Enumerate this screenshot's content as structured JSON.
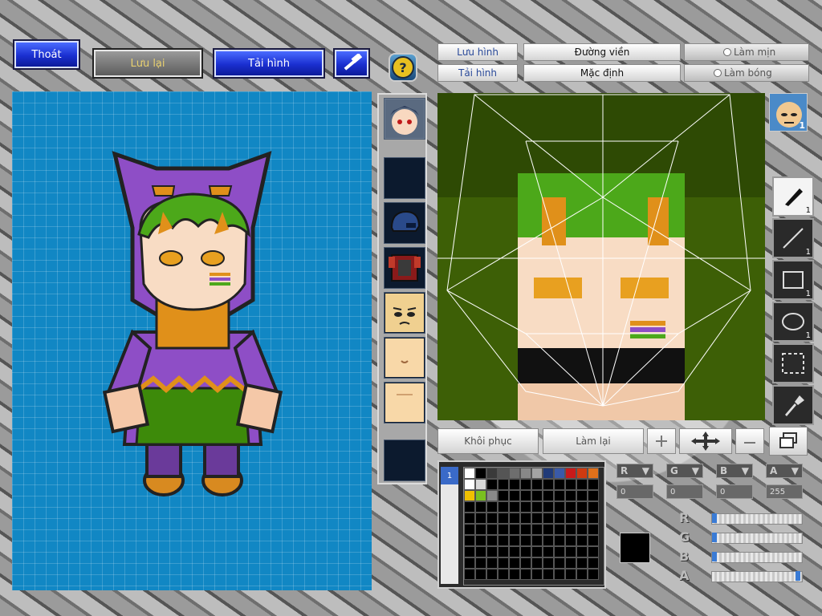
{
  "toolbar": {
    "exit_label": "Thoát",
    "save_label": "Lưu lại",
    "reload_label": "Tải hình",
    "help_symbol": "?"
  },
  "editor_toolbar": {
    "save_image": "Lưu hình",
    "load_image": "Tải hình",
    "outline": "Đường viền",
    "default": "Mặc định",
    "smooth": "Làm mịn",
    "shine": "Làm bóng"
  },
  "actions": {
    "restore": "Khôi phục",
    "redo": "Làm lại"
  },
  "tools": [
    {
      "name": "pen",
      "count": "1"
    },
    {
      "name": "line",
      "count": "1"
    },
    {
      "name": "rectangle",
      "count": "1"
    },
    {
      "name": "ellipse",
      "count": "1"
    },
    {
      "name": "select",
      "count": ""
    },
    {
      "name": "eyedropper",
      "count": ""
    }
  ],
  "character_badge": "1",
  "slots": [
    "face-top",
    "empty",
    "helmet",
    "armor",
    "face-1",
    "face-2",
    "face-3",
    "empty-2"
  ],
  "color_channels": {
    "r": {
      "label": "R",
      "value": "0"
    },
    "g": {
      "label": "G",
      "value": "0"
    },
    "b": {
      "label": "B",
      "value": "0"
    },
    "a": {
      "label": "A",
      "value": "255"
    }
  },
  "palette_tab": "1",
  "current_color": "#000000",
  "palette_row1": [
    "#ffffff",
    "#000000",
    "#3a3a3a",
    "#555555",
    "#6e6e6e",
    "#888888",
    "#a4a4a4",
    "#203a78",
    "#3a5aa8",
    "#c81a1a",
    "#d03a10",
    "#e0701a",
    "#c8a040"
  ],
  "palette_row2": [
    "#ffffff",
    "#d8d8d8"
  ],
  "palette_row3": [
    "#f0c000",
    "#7ac020",
    "#8a8a8a"
  ]
}
